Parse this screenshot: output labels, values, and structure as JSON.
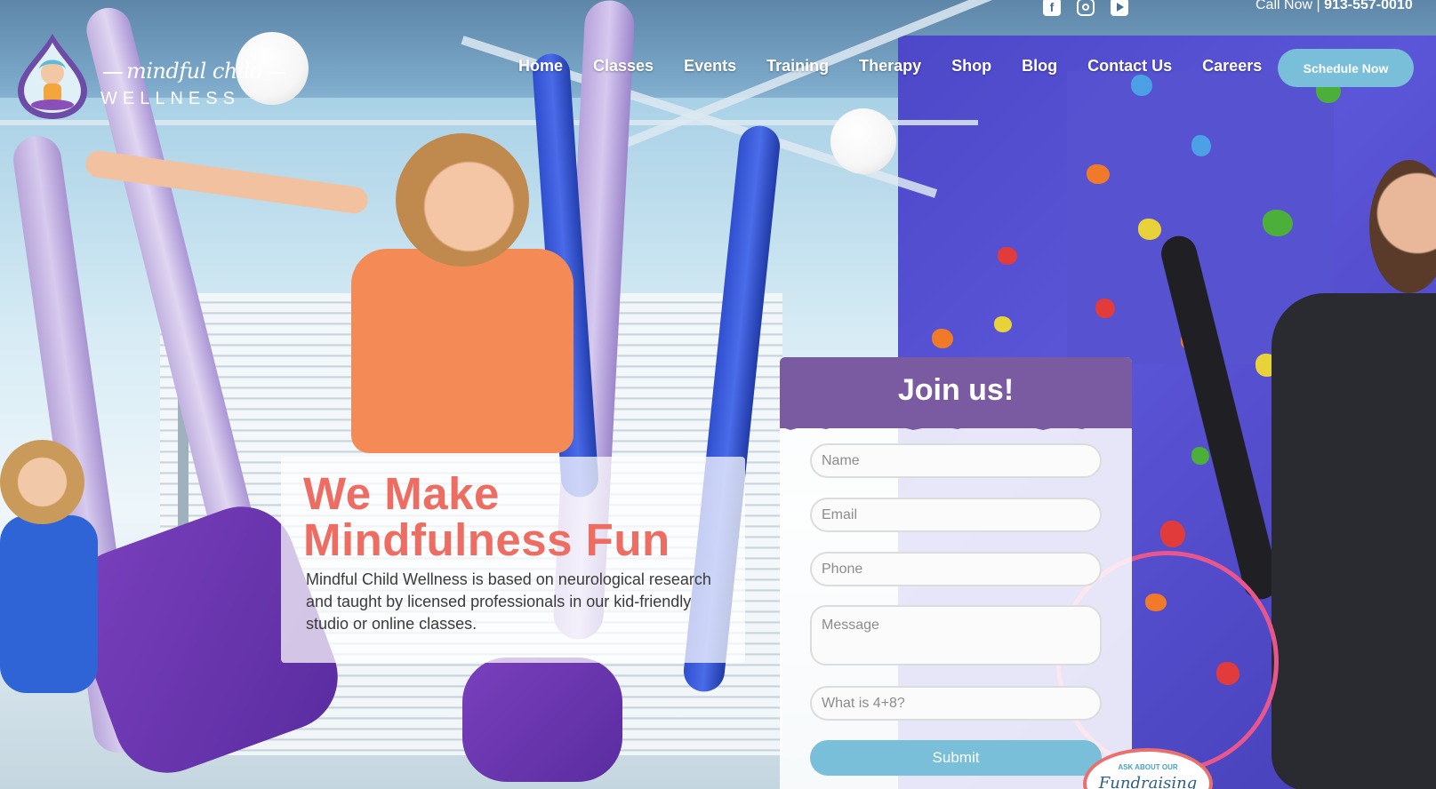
{
  "header": {
    "call_now_label": "Call Now |",
    "phone": "913-557-0010",
    "social": [
      {
        "icon": "facebook-icon"
      },
      {
        "icon": "instagram-icon"
      },
      {
        "icon": "youtube-icon"
      }
    ]
  },
  "logo": {
    "script": "mindful child",
    "word": "WELLNESS"
  },
  "nav": {
    "items": [
      "Home",
      "Classes",
      "Events",
      "Training",
      "Therapy",
      "Shop",
      "Blog",
      "Contact Us",
      "Careers"
    ],
    "cta": "Schedule Now"
  },
  "hero": {
    "title_line1": "We Make",
    "title_line2": "Mindfulness Fun",
    "description": "Mindful Child Wellness is based on neurological research and taught by licensed professionals in our kid-friendly studio or online classes."
  },
  "join_form": {
    "title": "Join us!",
    "fields": {
      "name": {
        "placeholder": "Name",
        "value": ""
      },
      "email": {
        "placeholder": "Email",
        "value": ""
      },
      "phone": {
        "placeholder": "Phone",
        "value": ""
      },
      "message": {
        "placeholder": "Message",
        "value": ""
      },
      "captcha": {
        "placeholder": "What is 4+8?",
        "value": ""
      }
    },
    "submit": "Submit"
  },
  "badge": {
    "text": "ASK ABOUT OUR",
    "script": "Fundraising"
  },
  "colors": {
    "accent_blue": "#79bfda",
    "title_coral": "#ee6d63",
    "form_purple": "#7a5aa0"
  }
}
